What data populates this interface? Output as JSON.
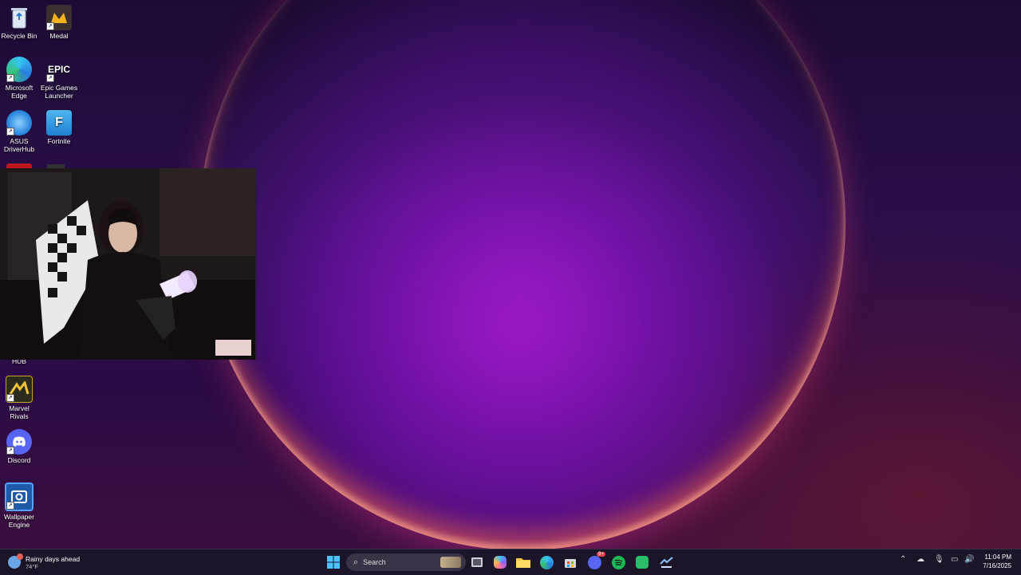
{
  "desktop": {
    "icons": [
      {
        "id": "recycle-bin",
        "label": "Recycle Bin",
        "icon": "recycle-bin-icon"
      },
      {
        "id": "medal",
        "label": "Medal",
        "icon": "medal-icon"
      },
      {
        "id": "edge",
        "label": "Microsoft Edge",
        "icon": "edge-icon"
      },
      {
        "id": "epic",
        "label": "Epic Games Launcher",
        "icon": "epic-games-icon",
        "glyph_text": "EPIC"
      },
      {
        "id": "asus",
        "label": "ASUS DriverHub",
        "icon": "asus-driverhub-icon"
      },
      {
        "id": "fortnite",
        "label": "Fortnite",
        "icon": "fortnite-icon",
        "glyph_text": "F"
      },
      {
        "id": "hub",
        "label": "HUB",
        "icon": "hub-icon"
      },
      {
        "id": "marvel",
        "label": "Marvel Rivals",
        "icon": "marvel-rivals-icon"
      },
      {
        "id": "discord",
        "label": "Discord",
        "icon": "discord-icon"
      },
      {
        "id": "wallpaper",
        "label": "Wallpaper Engine",
        "icon": "wallpaper-engine-icon"
      }
    ]
  },
  "webcam": {
    "description_icon": "webcam-overlay"
  },
  "taskbar": {
    "weather": {
      "title": "Rainy days ahead",
      "temp": "74°F",
      "icon": "weather-rain-icon"
    },
    "search_label": "Search",
    "pinned": [
      "start-icon",
      "search-icon",
      "task-view-icon",
      "copilot-icon",
      "file-explorer-icon",
      "edge-icon",
      "store-icon",
      "discord-icon",
      "spotify-icon",
      "android-app-icon",
      "steam-icon"
    ],
    "discord_badge": "9+",
    "tray": [
      "chevron-up-icon",
      "onedrive-icon",
      "microphone-icon",
      "display-icon",
      "volume-icon"
    ],
    "time": "11:04 PM",
    "date": "7/16/2025"
  },
  "colors": {
    "taskbar": "#1c1628",
    "accent": "#0078d4",
    "spotify": "#1db954",
    "discord": "#5865f2"
  }
}
